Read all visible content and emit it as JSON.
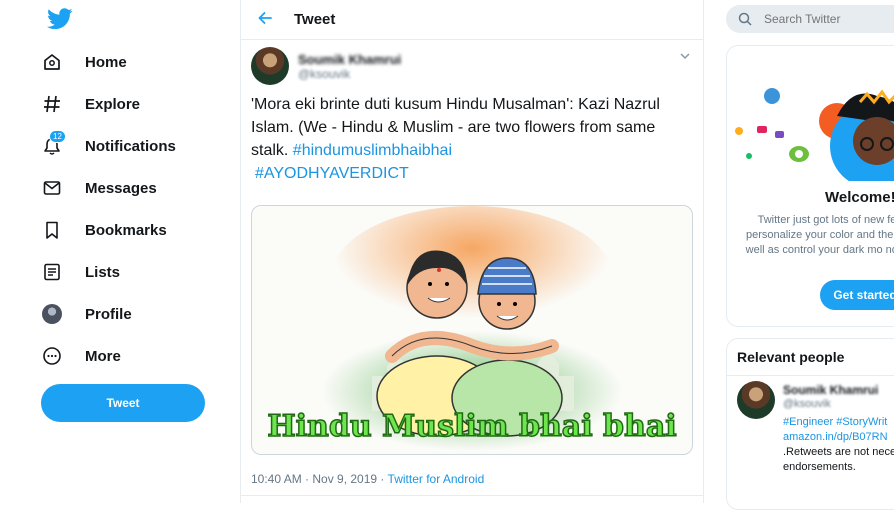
{
  "nav": {
    "items": [
      {
        "label": "Home",
        "icon": "home-icon"
      },
      {
        "label": "Explore",
        "icon": "hashtag-icon"
      },
      {
        "label": "Notifications",
        "icon": "bell-icon",
        "badge": "12"
      },
      {
        "label": "Messages",
        "icon": "envelope-icon"
      },
      {
        "label": "Bookmarks",
        "icon": "bookmark-icon"
      },
      {
        "label": "Lists",
        "icon": "list-icon"
      },
      {
        "label": "Profile",
        "icon": "avatar"
      },
      {
        "label": "More",
        "icon": "more-icon"
      }
    ],
    "tweet_button": "Tweet"
  },
  "header": {
    "title": "Tweet"
  },
  "tweet": {
    "author_name": "Soumik Khamrui",
    "author_handle": "@ksouvik",
    "text": "'Mora eki brinte duti kusum Hindu Musalman': Kazi Nazrul Islam. (We - Hindu & Muslim -  are two flowers from same stalk. ",
    "hashtag1": "#hindumuslimbhaibhai",
    "hashtag2": "#AYODHYAVERDICT",
    "image_caption": "Hindu Muslim bhai bhai",
    "time": "10:40 AM · Nov 9, 2019 · ",
    "source": "Twitter for Android"
  },
  "search": {
    "placeholder": "Search Twitter"
  },
  "welcome": {
    "title": "Welcome!",
    "body": "Twitter just got lots of new fe personalize your color and the as well as control your dark mo now.",
    "button": "Get started"
  },
  "relevant": {
    "title": "Relevant people",
    "person": {
      "name": "Soumik Khamrui",
      "handle": "@ksouvik",
      "bio_line1": "#Engineer #StoryWrit",
      "bio_line2": "amazon.in/dp/B07RN",
      "bio_line3": ".Retweets are not nece",
      "bio_line4": "endorsements."
    }
  },
  "colors": {
    "accent": "#1da1f2",
    "link": "#1b95e0",
    "border": "#e6ecf0"
  }
}
